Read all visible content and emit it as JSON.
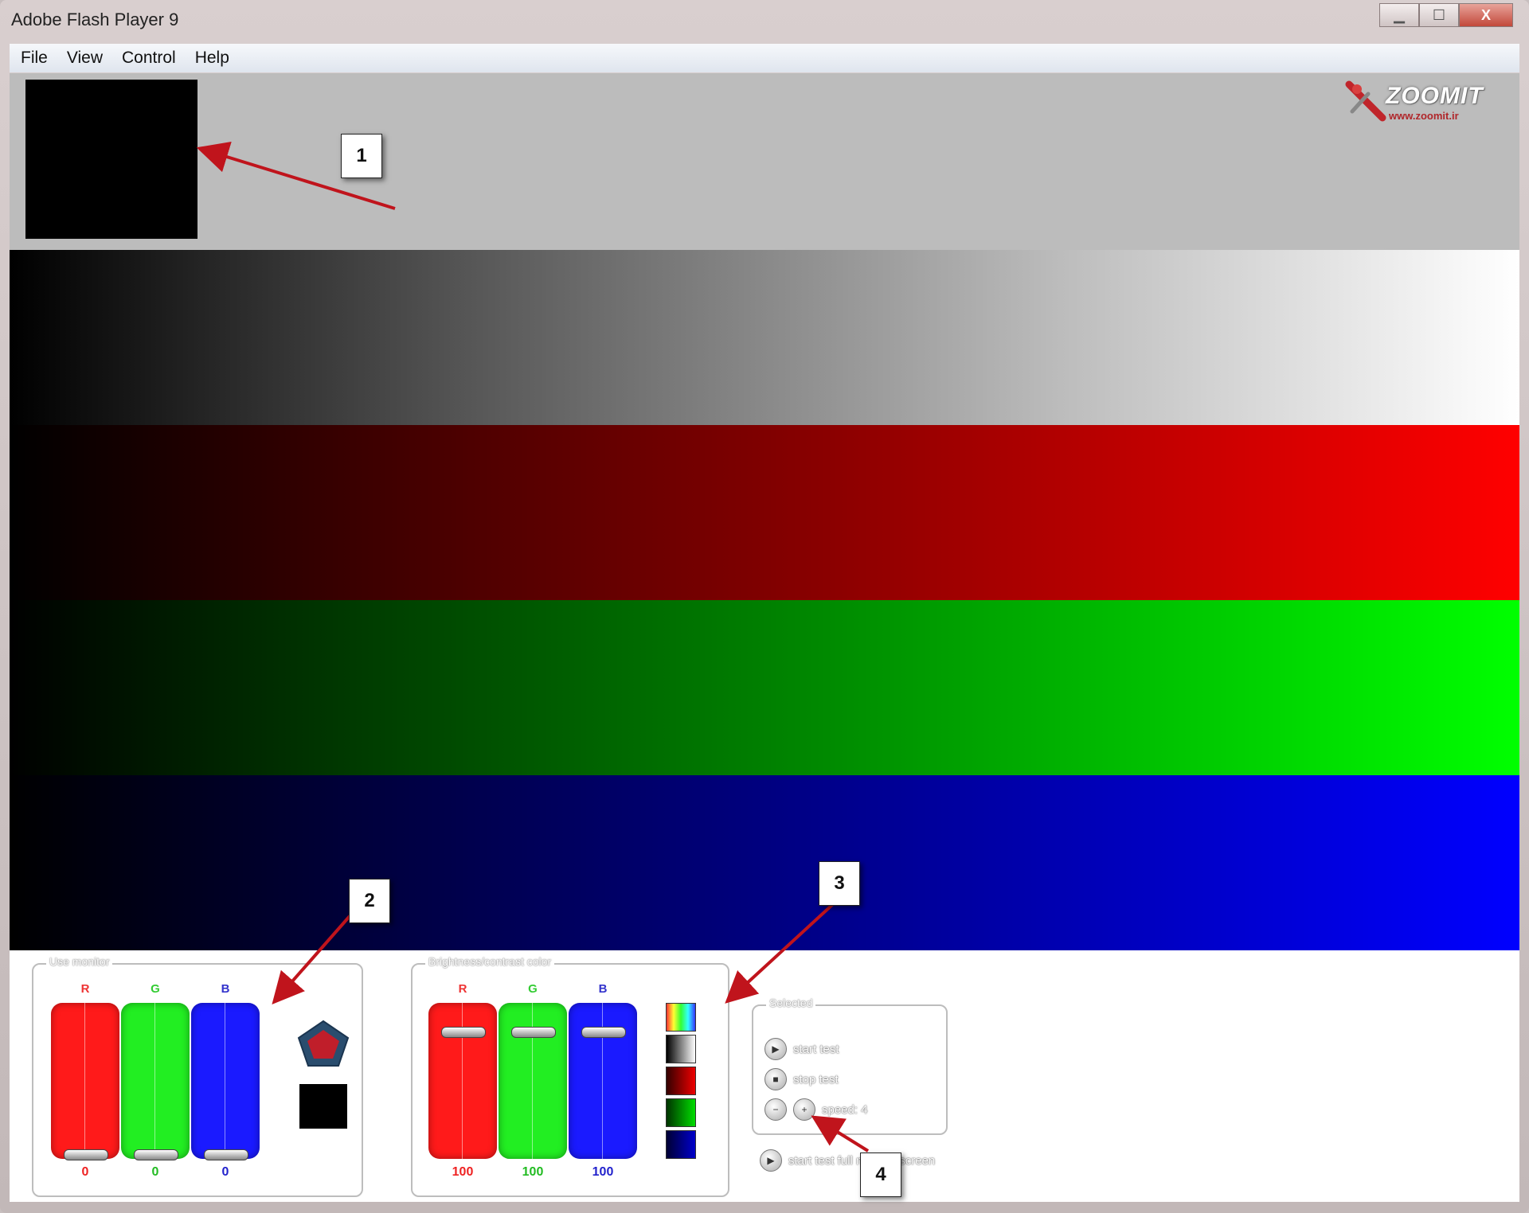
{
  "window": {
    "title": "Adobe Flash Player 9",
    "minimize_icon": "minimize-icon",
    "maximize_icon": "maximize-icon",
    "close_label": "X"
  },
  "menu": {
    "items": [
      "File",
      "View",
      "Control",
      "Help"
    ]
  },
  "logo": {
    "text": "ZOOMIT",
    "url": "www.zoomit.ir"
  },
  "bands": {
    "colors": [
      "#ffffff",
      "#ff0000",
      "#00ff00",
      "#0000ff"
    ]
  },
  "panel1": {
    "title": "Use monitor",
    "channels": [
      {
        "label": "R",
        "value": "0",
        "color": "#ff0000",
        "level": 0
      },
      {
        "label": "G",
        "value": "0",
        "color": "#00ff00",
        "level": 0
      },
      {
        "label": "B",
        "value": "0",
        "color": "#0000ff",
        "level": 0
      }
    ],
    "swatch_color": "#000000"
  },
  "panel2": {
    "title": "Brightness/contrast color",
    "channels": [
      {
        "label": "R",
        "value": "100",
        "color": "#ff0000",
        "level": 1
      },
      {
        "label": "G",
        "value": "100",
        "color": "#00ff00",
        "level": 1
      },
      {
        "label": "B",
        "value": "100",
        "color": "#0000ff",
        "level": 1
      }
    ]
  },
  "panel3": {
    "title": "Selected",
    "options": [
      "start test",
      "stop test",
      "speed: 4"
    ],
    "extra_option": "start test full monitor screen"
  },
  "callouts": [
    "1",
    "2",
    "3",
    "4"
  ]
}
